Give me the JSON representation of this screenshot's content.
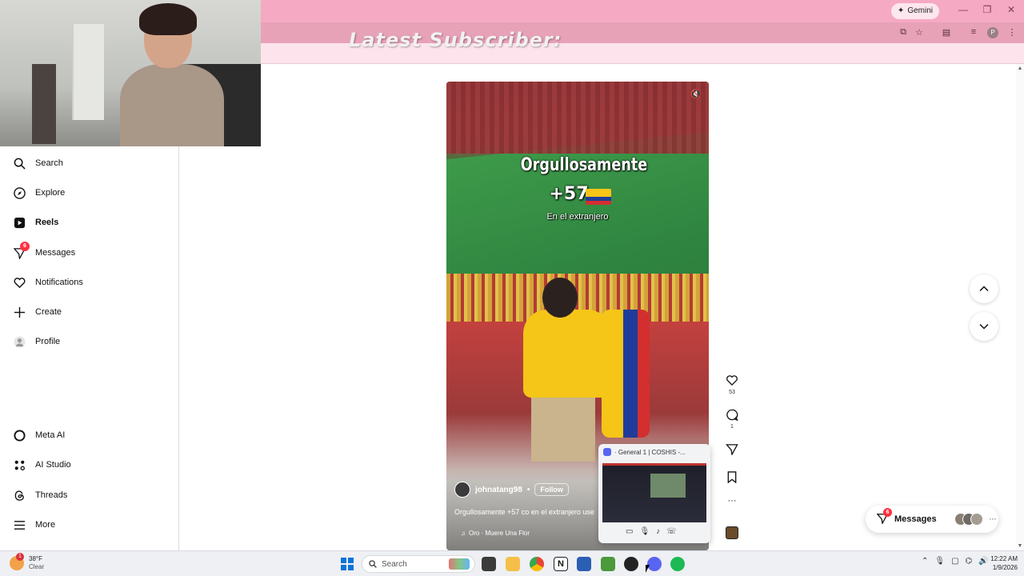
{
  "browser": {
    "gemini_label": "Gemini",
    "profile_initial": "P"
  },
  "overlay": {
    "latest_subscriber": "Latest Subscriber:"
  },
  "sidebar": {
    "items": [
      {
        "label": "Search",
        "icon": "search-icon"
      },
      {
        "label": "Explore",
        "icon": "compass-icon"
      },
      {
        "label": "Reels",
        "icon": "reels-icon",
        "active": true
      },
      {
        "label": "Messages",
        "icon": "messenger-icon",
        "badge": "6"
      },
      {
        "label": "Notifications",
        "icon": "heart-icon"
      },
      {
        "label": "Create",
        "icon": "plus-icon"
      },
      {
        "label": "Profile",
        "icon": "avatar-icon"
      },
      {
        "label": "Meta AI",
        "icon": "meta-ai-icon"
      },
      {
        "label": "AI Studio",
        "icon": "ai-studio-icon"
      },
      {
        "label": "Threads",
        "icon": "threads-icon"
      },
      {
        "label": "More",
        "icon": "menu-icon"
      }
    ]
  },
  "reel": {
    "caption_line1": "Orgullosamente",
    "caption_line2": "+57",
    "caption_line3": "En el extranjero",
    "username": "johnatang98",
    "dot": "•",
    "follow_label": "Follow",
    "description": "Orgullosamente +57 co en el extranjero use",
    "audio": "Oro · Muere Una Flor",
    "audio_note_icon": "♫"
  },
  "actions": {
    "likes": "53",
    "comments": "1"
  },
  "discord": {
    "title": "· General 1 | COSHIS -..."
  },
  "messages_pill": {
    "label": "Messages",
    "badge": "6",
    "more": "···"
  },
  "taskbar": {
    "weather_temp": "38°F",
    "weather_desc": "Clear",
    "weather_badge": "1",
    "search_placeholder": "Search",
    "time": "12:22 AM",
    "date": "1/9/2026"
  },
  "colors": {
    "browser_top": "#f6a9c2",
    "sidebar_border": "#dbdbdb",
    "badge_red": "#ff3040",
    "discord_blurple": "#5865f2"
  }
}
